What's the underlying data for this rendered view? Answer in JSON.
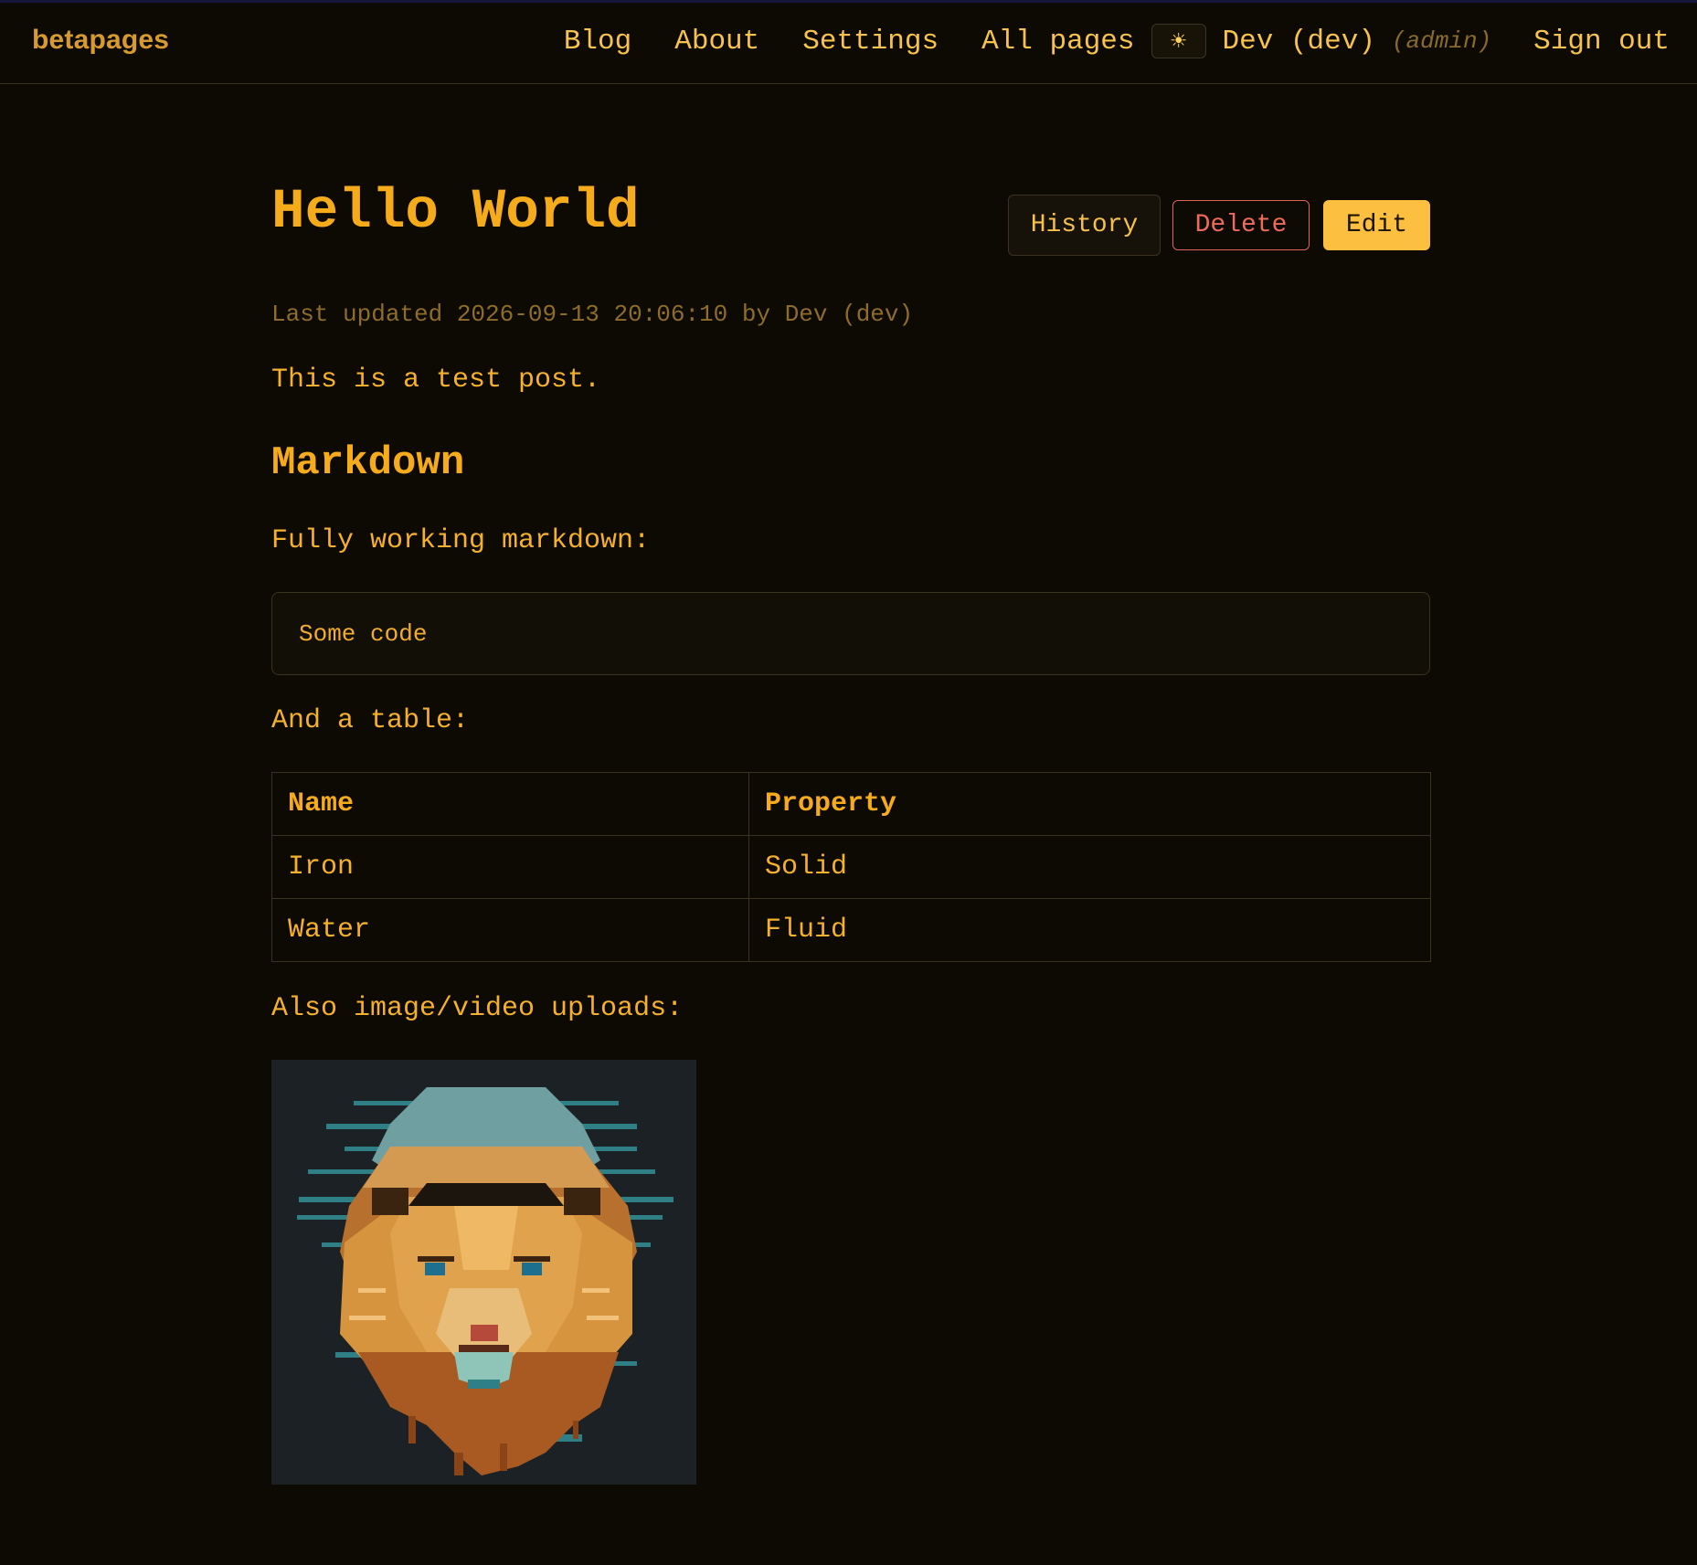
{
  "header": {
    "brand": "betapages",
    "nav": [
      "Blog",
      "About",
      "Settings",
      "All pages"
    ],
    "theme_icon": "☀",
    "user": "Dev (dev)",
    "role": "(admin)",
    "sign_out": "Sign out"
  },
  "page": {
    "title": "Hello World",
    "actions": {
      "history": "History",
      "delete": "Delete",
      "edit": "Edit"
    },
    "meta": "Last updated 2026-09-13 20:06:10 by Dev (dev)",
    "intro": "This is a test post.",
    "heading": "Markdown",
    "markdown_text": "Fully working markdown:",
    "code": "Some code",
    "table_intro": "And a table:",
    "table": {
      "headers": [
        "Name",
        "Property"
      ],
      "rows": [
        [
          "Iron",
          "Solid"
        ],
        [
          "Water",
          "Fluid"
        ]
      ]
    },
    "upload_text": "Also image/video uploads:"
  },
  "colors": {
    "background": "#0c0a03",
    "accent": "#f6ab1a",
    "edit_button": "#fdbf40",
    "delete_button": "#e0645a",
    "border": "#3a3322"
  }
}
